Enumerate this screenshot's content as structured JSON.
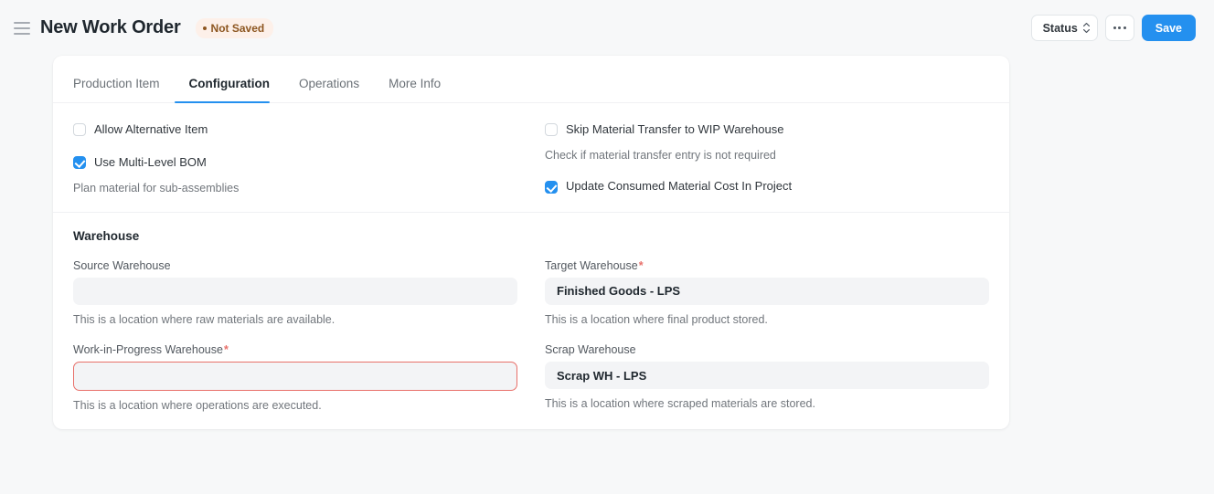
{
  "header": {
    "menu_icon": "hamburger-icon",
    "title": "New Work Order",
    "status_badge": "Not Saved",
    "status_button": "Status",
    "ellipsis_label": "...",
    "save_button": "Save",
    "accent_color": "#2490ef",
    "badge_bg": "#fdf0e9",
    "badge_fg": "#8d5620"
  },
  "tabs": [
    {
      "label": "Production Item",
      "active": false
    },
    {
      "label": "Configuration",
      "active": true
    },
    {
      "label": "Operations",
      "active": false
    },
    {
      "label": "More Info",
      "active": false
    }
  ],
  "options": {
    "left": [
      {
        "label": "Allow Alternative Item",
        "checked": false,
        "helper": ""
      },
      {
        "label": "Use Multi-Level BOM",
        "checked": true,
        "helper": "Plan material for sub-assemblies"
      }
    ],
    "right": [
      {
        "label": "Skip Material Transfer to WIP Warehouse",
        "checked": false,
        "helper": "Check if material transfer entry is not required"
      },
      {
        "label": "Update Consumed Material Cost In Project",
        "checked": true,
        "helper": ""
      }
    ]
  },
  "warehouse": {
    "heading": "Warehouse",
    "fields": {
      "source": {
        "label": "Source Warehouse",
        "required": false,
        "value": "",
        "helper": "This is a location where raw materials are available.",
        "invalid": false
      },
      "target": {
        "label": "Target Warehouse",
        "required": true,
        "required_marker": "*",
        "value": "Finished Goods - LPS",
        "helper": "This is a location where final product stored.",
        "invalid": false
      },
      "wip": {
        "label": "Work-in-Progress Warehouse",
        "required": true,
        "required_marker": "*",
        "value": "",
        "helper": "This is a location where operations are executed.",
        "invalid": true,
        "error_color": "#e8706a"
      },
      "scrap": {
        "label": "Scrap Warehouse",
        "required": false,
        "value": "Scrap WH - LPS",
        "helper": "This is a location where scraped materials are stored.",
        "invalid": false
      }
    }
  }
}
